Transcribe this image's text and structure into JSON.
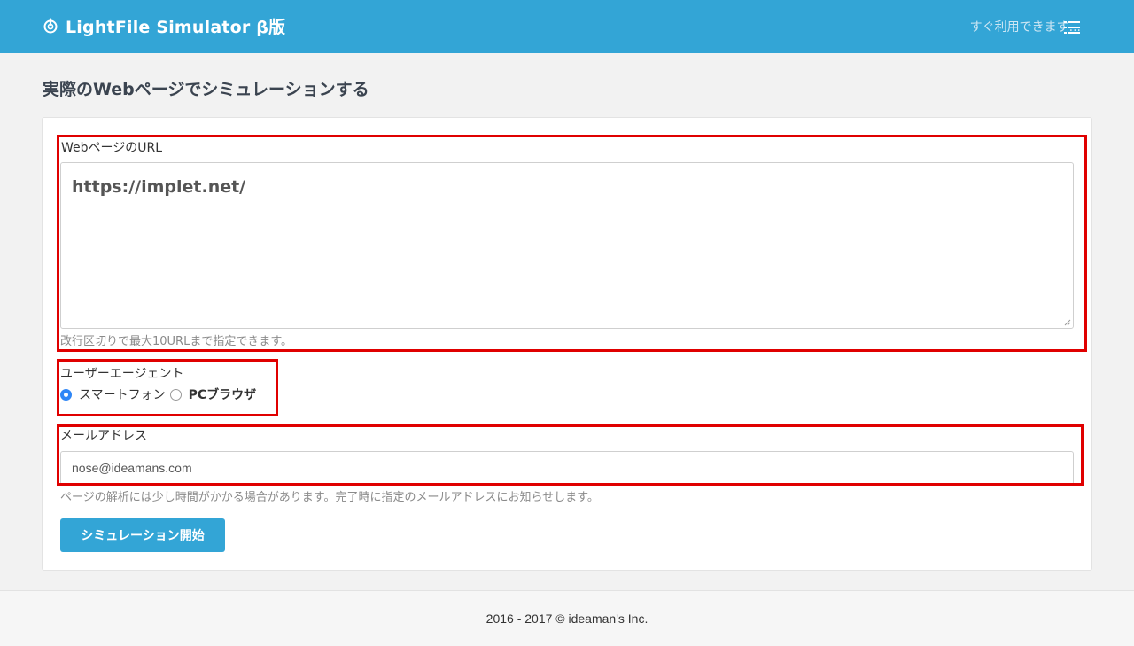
{
  "header": {
    "brand": "LightFile Simulator β版",
    "nav_link": "すぐ利用できます..."
  },
  "page": {
    "title": "実際のWebページでシミュレーションする"
  },
  "form": {
    "url_label": "WebページのURL",
    "url_value": "https://implet.net/",
    "url_help": "改行区切りで最大10URLまで指定できます。",
    "ua_label": "ユーザーエージェント",
    "ua_options": [
      {
        "label": "スマートフォン",
        "selected": true
      },
      {
        "label": "PCブラウザ",
        "selected": false
      }
    ],
    "email_label": "メールアドレス",
    "email_value": "nose@ideamans.com",
    "email_help": "ページの解析には少し時間がかかる場合があります。完了時に指定のメールアドレスにお知らせします。",
    "submit_label": "シミュレーション開始"
  },
  "footer": {
    "text": "2016 - 2017 © ideaman's Inc."
  },
  "colors": {
    "primary": "#33a5d6",
    "highlight": "#e00000",
    "radio_selected": "#2f86f6"
  }
}
